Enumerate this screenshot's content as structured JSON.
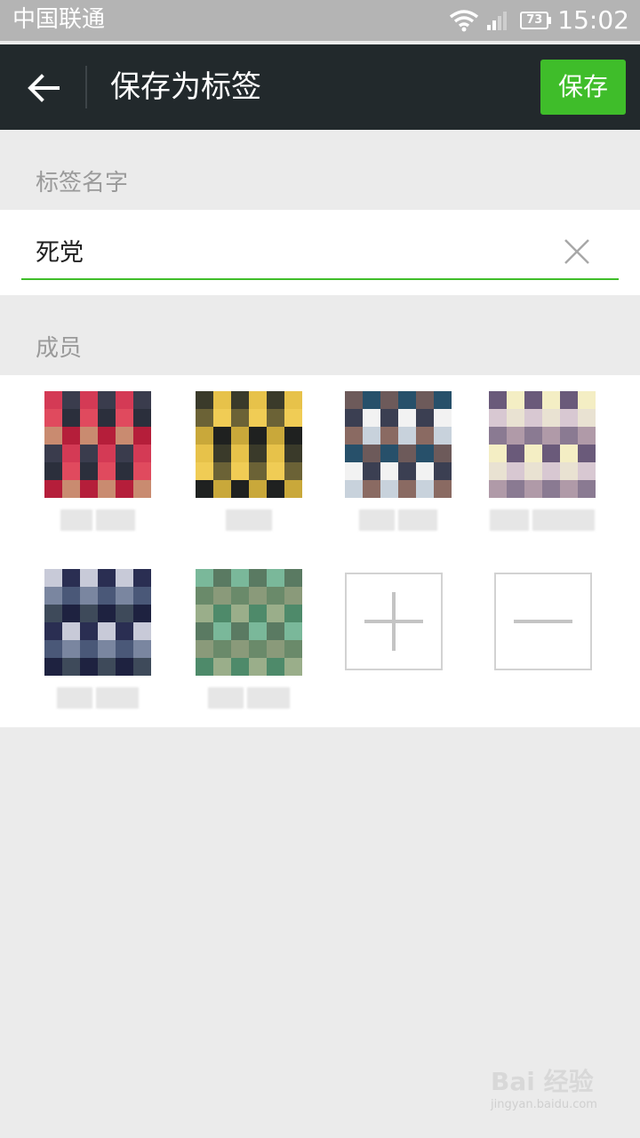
{
  "status_bar": {
    "carrier": "中国联通",
    "battery_level": "73",
    "time": "15:02",
    "icons": [
      "wifi-icon",
      "signal-icon",
      "battery-icon"
    ]
  },
  "header": {
    "title": "保存为标签",
    "save_label": "保存",
    "back_icon": "arrow-left-icon"
  },
  "tag_name": {
    "section_label": "标签名字",
    "value": "死党",
    "clear_icon": "close-icon"
  },
  "members": {
    "section_label": "成员",
    "items": [
      {
        "avatar_colors": [
          "#d43a55",
          "#e04a5e",
          "#c98b70",
          "#3a3c4d",
          "#2b2f3c",
          "#b51e3a"
        ],
        "name_blurred": true
      },
      {
        "avatar_colors": [
          "#1f2120",
          "#3a3a2a",
          "#6b6236",
          "#c9a83a",
          "#e7c24a",
          "#f0cc55"
        ],
        "name_blurred": true
      },
      {
        "avatar_colors": [
          "#f2f2f2",
          "#c8d2dc",
          "#6d5a5a",
          "#3b3f52",
          "#8a6a62",
          "#27506a"
        ],
        "name_blurred": true
      },
      {
        "avatar_colors": [
          "#f4eec4",
          "#e9e2d2",
          "#b09aa8",
          "#6a5a7a",
          "#d8c8d2",
          "#8a7a92"
        ],
        "name_blurred": true
      },
      {
        "avatar_colors": [
          "#3e4a5a",
          "#2a2e52",
          "#4a5878",
          "#1e2240",
          "#c8cad8",
          "#7a86a0"
        ],
        "name_blurred": true
      },
      {
        "avatar_colors": [
          "#6a8a6a",
          "#9aae8a",
          "#5a7a62",
          "#8a9a7a",
          "#4e8a6a",
          "#7ab89a"
        ],
        "name_blurred": true
      }
    ],
    "add_icon": "plus-icon",
    "remove_icon": "minus-icon"
  },
  "watermark": {
    "text": "Bai 经验",
    "sub": "jingyan.baidu.com"
  }
}
